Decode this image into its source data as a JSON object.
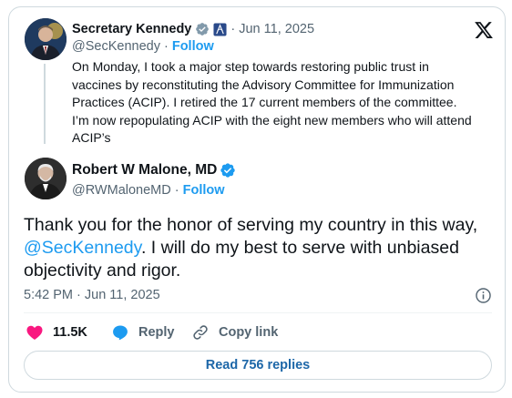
{
  "quoted": {
    "name": "Secretary Kennedy",
    "date": "· Jun 11, 2025",
    "handle": "@SecKennedy",
    "dot": " · ",
    "follow": "Follow",
    "text": "On Monday, I took a major step towards restoring public trust in vaccines by reconstituting the Advisory Committee for Immunization Practices (ACIP). I retired the 17 current members of the committee. I’m now repopulating ACIP with the eight new members who will attend ACIP’s"
  },
  "tweet": {
    "name": "Robert W Malone, MD",
    "handle": "@RWMaloneMD",
    "dot": " · ",
    "follow": "Follow",
    "text_before": "Thank you for the honor of serving my country in this way, ",
    "mention": "@SecKennedy",
    "text_after": ".  I will do my best to serve with unbiased objectivity and rigor.",
    "timestamp": "5:42 PM · Jun 11, 2025"
  },
  "actions": {
    "likes": "11.5K",
    "reply": "Reply",
    "copy_link": "Copy link"
  },
  "read_replies": "Read 756 replies",
  "colors": {
    "accent": "#1d9bf0",
    "like": "#f91880",
    "verified": "#1d9bf0",
    "gov_badge": "#829aab"
  },
  "icons": [
    "x-logo-icon",
    "gov-badge-icon",
    "flag-badge-icon",
    "verified-icon",
    "info-icon",
    "heart-icon",
    "reply-icon",
    "link-icon"
  ]
}
